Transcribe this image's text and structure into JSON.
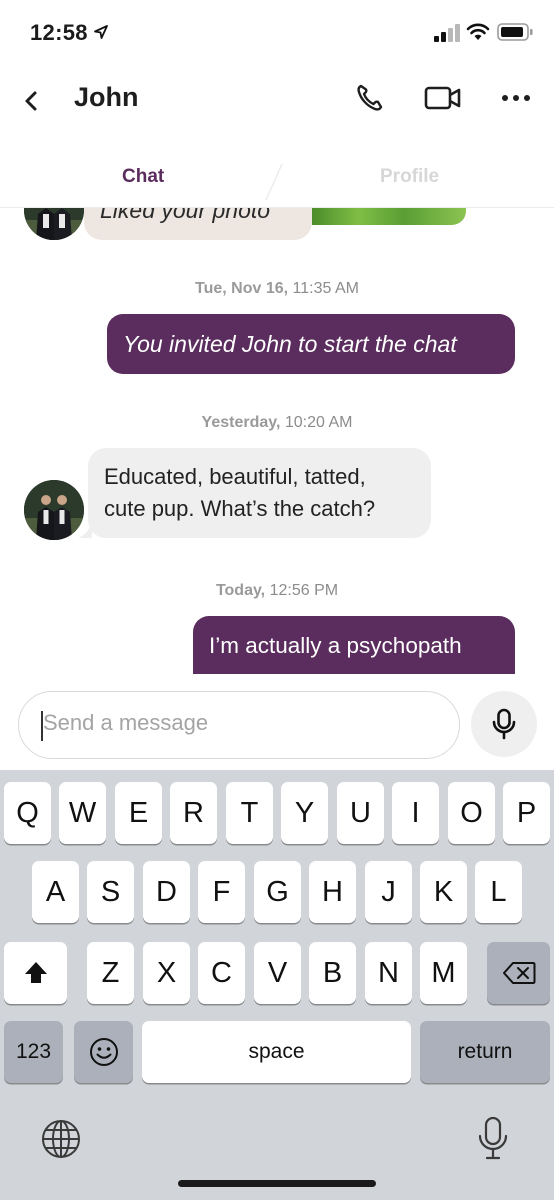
{
  "status_bar": {
    "time": "12:58",
    "icons": [
      "location-arrow-icon",
      "signal-icon",
      "wifi-icon",
      "battery-icon"
    ]
  },
  "nav": {
    "title": "John",
    "icons": [
      "back-chevron-icon",
      "phone-icon",
      "video-call-icon",
      "more-dots-icon"
    ]
  },
  "tabs": [
    {
      "label": "Chat",
      "active": true
    },
    {
      "label": "Profile",
      "active": false
    }
  ],
  "messages": {
    "liked": "Liked your photo",
    "ts1_day": "Tue, Nov 16,",
    "ts1_time": "11:35 AM",
    "msg1": "You invited John to start the chat",
    "ts2_day": "Yesterday,",
    "ts2_time": "10:20 AM",
    "msg2_line1": "Educated, beautiful, tatted,",
    "msg2_line2": "cute pup. What’s the catch?",
    "ts3_day": "Today,",
    "ts3_time": "12:56 PM",
    "msg3": "I’m actually a psychopath"
  },
  "composer": {
    "placeholder": "Send a message",
    "mic_icon": "microphone-icon"
  },
  "keyboard": {
    "row1": [
      "Q",
      "W",
      "E",
      "R",
      "T",
      "Y",
      "U",
      "I",
      "O",
      "P"
    ],
    "row2": [
      "A",
      "S",
      "D",
      "F",
      "G",
      "H",
      "J",
      "K",
      "L"
    ],
    "row3": [
      "Z",
      "X",
      "C",
      "V",
      "B",
      "N",
      "M"
    ],
    "numbers": "123",
    "space": "space",
    "return": "return"
  },
  "colors": {
    "accent": "#5b2d5e",
    "incoming_bubble": "#efefef",
    "keyboard_bg": "#d1d4d9"
  }
}
